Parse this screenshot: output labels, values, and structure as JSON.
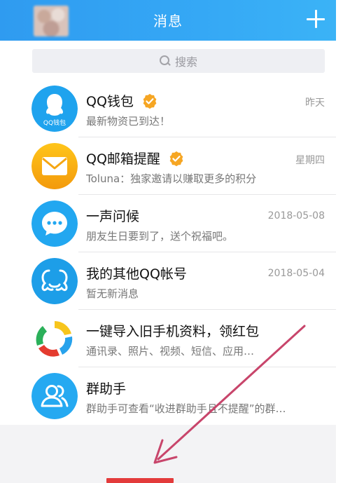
{
  "header": {
    "title": "消息"
  },
  "search": {
    "placeholder": "搜索"
  },
  "messages": [
    {
      "name": "QQ钱包",
      "text": "最新物资已到达！",
      "time": "昨天",
      "icon_label": "QQ钱包"
    },
    {
      "name": "QQ邮箱提醒",
      "text": "Toluna：独家邀请以赚取更多的积分",
      "time": "星期四"
    },
    {
      "name": "一声问候",
      "text": "朋友生日要到了，送个祝福吧。",
      "time": "2018-05-08"
    },
    {
      "name": "我的其他QQ帐号",
      "text": "暂无新消息",
      "time": "2018-05-04"
    },
    {
      "name": "一键导入旧手机资料，领红包",
      "text": "通讯录、照片、视频、短信、应用…",
      "time": ""
    },
    {
      "name": "群助手",
      "text": "群助手可查看“收进群助手且不提醒”的群…",
      "time": ""
    }
  ],
  "colors": {
    "header_blue": "#35a8f5",
    "arrow": "#c8456b",
    "badge_orange": "#f6a623"
  }
}
